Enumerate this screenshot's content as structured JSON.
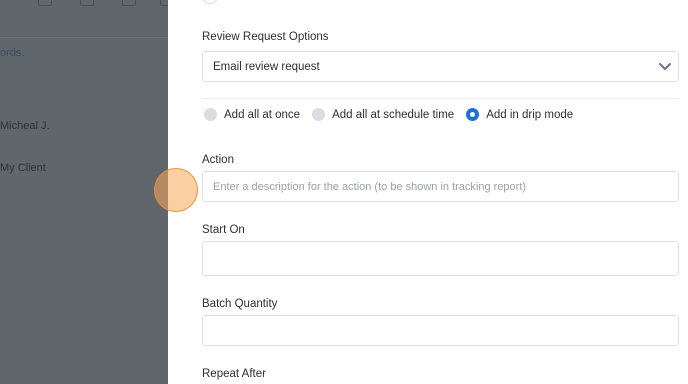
{
  "background": {
    "snippets": [
      "ords.",
      "Micheal J.",
      "My Client"
    ]
  },
  "form": {
    "review_request": {
      "label": "Review Request Options",
      "selected": "Email review request"
    },
    "radios": [
      {
        "label": "Add all at once",
        "checked": false
      },
      {
        "label": "Add all at schedule time",
        "checked": false
      },
      {
        "label": "Add in drip mode",
        "checked": true
      }
    ],
    "action": {
      "label": "Action",
      "placeholder": "Enter a description for the action (to be shown in tracking report)"
    },
    "start_on": {
      "label": "Start On",
      "value": ""
    },
    "batch_quantity": {
      "label": "Batch Quantity",
      "value": ""
    },
    "repeat_after": {
      "label": "Repeat After"
    }
  },
  "colors": {
    "accent": "#1e6fd9",
    "overlay": "#5f666c",
    "cursor_highlight": "#f7a85a"
  }
}
